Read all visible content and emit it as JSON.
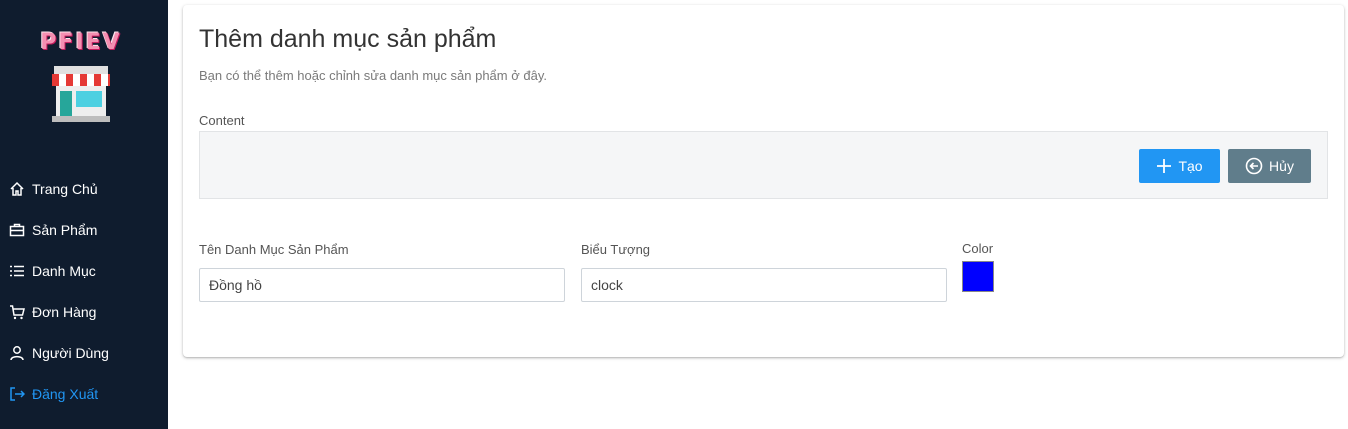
{
  "brand": {
    "name": "PFIEV"
  },
  "sidebar": {
    "items": [
      {
        "label": "Trang Chủ",
        "icon": "home-icon"
      },
      {
        "label": "Sản Phẩm",
        "icon": "briefcase-icon"
      },
      {
        "label": "Danh Mục",
        "icon": "list-icon"
      },
      {
        "label": "Đơn Hàng",
        "icon": "cart-icon"
      },
      {
        "label": "Người Dùng",
        "icon": "user-icon"
      },
      {
        "label": "Đăng Xuất",
        "icon": "logout-icon"
      }
    ]
  },
  "form": {
    "title": "Thêm danh mục sản phẩm",
    "subtitle": "Bạn có thể thêm hoặc chỉnh sửa danh mục sản phẩm ở đây.",
    "content_label": "Content",
    "create_label": "Tạo",
    "cancel_label": "Hủy",
    "name_label": "Tên Danh Mục Sản Phẩm",
    "name_value": "Đồng hồ",
    "icon_label": "Biểu Tượng",
    "icon_value": "clock",
    "color_label": "Color",
    "color_value": "#0000ff"
  },
  "colors": {
    "sidebar_bg": "#0f1c2e",
    "accent": "#2196f3",
    "cancel": "#607d8b",
    "active_nav": "#2196f3"
  }
}
